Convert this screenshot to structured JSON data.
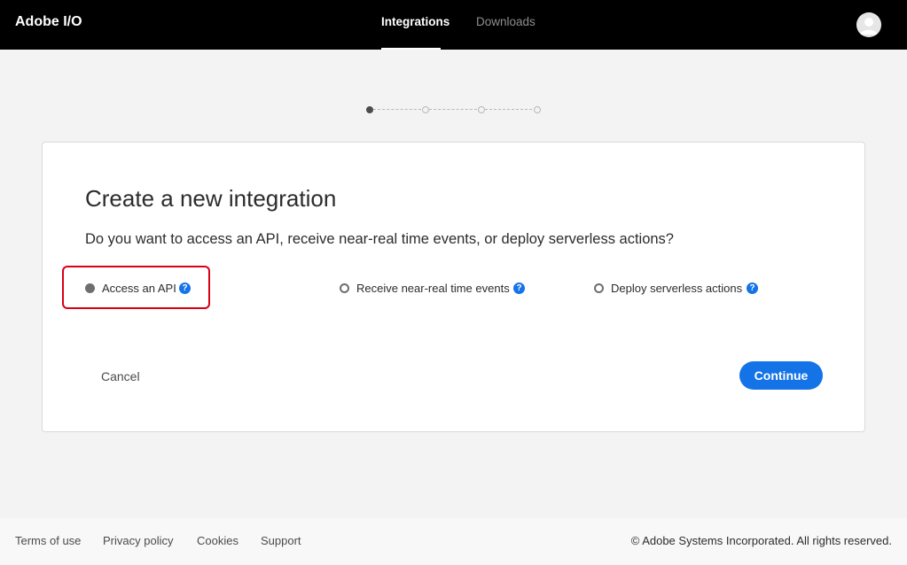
{
  "header": {
    "brand": "Adobe I/O",
    "tabs": [
      {
        "label": "Integrations",
        "active": true
      },
      {
        "label": "Downloads",
        "active": false
      }
    ],
    "avatar_icon": "user-avatar-icon"
  },
  "stepper": {
    "total_steps": 4,
    "current_step": 1
  },
  "card": {
    "title": "Create a new integration",
    "question": "Do you want to access an API, receive near-real time events, or deploy serverless actions?",
    "options": [
      {
        "label": "Access an API",
        "selected": true,
        "help_icon": "question-icon"
      },
      {
        "label": "Receive near-real time events",
        "selected": false,
        "help_icon": "question-icon"
      },
      {
        "label": "Deploy serverless actions",
        "selected": false,
        "help_icon": "question-icon"
      }
    ],
    "help_glyph": "?",
    "cancel_label": "Cancel",
    "continue_label": "Continue"
  },
  "footer": {
    "links": [
      "Terms of use",
      "Privacy policy",
      "Cookies",
      "Support"
    ],
    "copyright": "© Adobe Systems Incorporated. All rights reserved."
  },
  "colors": {
    "topbar": "#000000",
    "accent": "#1473e6",
    "highlight": "#d70015",
    "background": "#f3f3f3"
  }
}
